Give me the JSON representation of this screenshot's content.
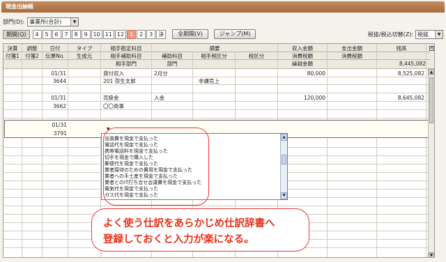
{
  "window": {
    "title": "現金出納帳"
  },
  "department": {
    "label": "部門(D):",
    "value": "事業所(合計)"
  },
  "period_button": "期間(Q)",
  "month_tabs": [
    {
      "label": "4"
    },
    {
      "label": "5"
    },
    {
      "label": "6"
    },
    {
      "label": "7"
    },
    {
      "label": "8"
    },
    {
      "label": "9"
    },
    {
      "label": "10"
    },
    {
      "label": "11"
    },
    {
      "label": "12"
    },
    {
      "label": "1"
    },
    {
      "label": "2"
    },
    {
      "label": "3"
    },
    {
      "label": "決"
    }
  ],
  "active_tab": "1",
  "all_period_button": "全期間(V)",
  "jump_button": "ジャンプ(M)",
  "tax_switch": {
    "label": "税抜/税込切替(Z):",
    "value": "税抜"
  },
  "header": {
    "row1": [
      "決算",
      "調整",
      "日付",
      "タイプ",
      "相手勘定科目",
      "摘要",
      "収入金額",
      "支出金額",
      "残高"
    ],
    "row2": [
      "付箋1",
      "付箋2",
      "伝票No.",
      "生成元",
      "相手補助科目",
      "補助科目",
      "相手税区分",
      "税区分",
      "消費税額",
      "消費税額"
    ],
    "row3_dept": "相手部門",
    "row3_dept2": "部門",
    "carry_over": "繰越金額",
    "carry_value": "8,445,082"
  },
  "rows": [
    {
      "date": "01/31",
      "slip": "3644",
      "account": "貸付収入",
      "sub": "201 弥生太郎",
      "summary": "2月分",
      "tax": "非課売上",
      "income": "80,000",
      "balance": "8,525,082"
    },
    {
      "date": "01/31",
      "slip": "3662",
      "account": "売掛金",
      "sub": "〇〇商事",
      "summary": "入金",
      "tax": "",
      "income": "120,000",
      "balance": "8,645,082"
    }
  ],
  "entry_row": {
    "date": "01/31",
    "slip": "3791"
  },
  "popup": {
    "items": [
      "出張費を現金で支払った",
      "電話代を現金で支払った",
      "携帯電話料を現金で支払った",
      "切手を現金で購入した",
      "郵便代を現金で支払った",
      "業者接待のための費用を現金で支払った",
      "業者への手土産を現金で支払った",
      "業者とのIT打ち合せ会議費を現金で支払った",
      "電気代を現金で支払った",
      "ガス代を現金で支払った"
    ]
  },
  "callout": {
    "line1": "よく使う仕訳をあらかじめ仕訳辞書へ",
    "line2": "登録しておくと入力が楽になる。"
  },
  "colors": {
    "accent": "#e6331a",
    "title_bar": "#b0764a",
    "active_tab": "#f19880"
  }
}
